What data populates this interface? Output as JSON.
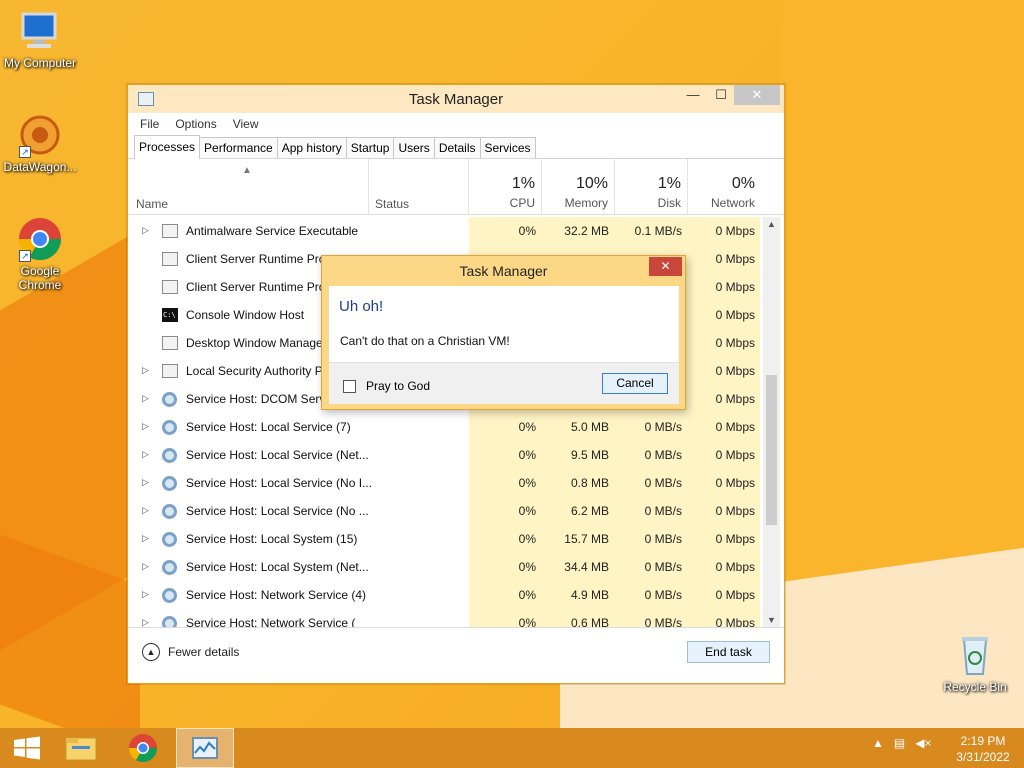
{
  "desktop": {
    "icons": [
      {
        "label": "My Computer",
        "icon": "computer-icon"
      },
      {
        "label": "DataWagon...",
        "icon": "datawagon-icon"
      },
      {
        "label": "Google Chrome",
        "icon": "chrome-icon"
      },
      {
        "label": "Recycle Bin",
        "icon": "recycle-bin-icon"
      }
    ]
  },
  "task_manager": {
    "title": "Task Manager",
    "window_buttons": {
      "minimize": "—",
      "maximize": "☐",
      "close": "✕"
    },
    "menu": [
      "File",
      "Options",
      "View"
    ],
    "tabs": [
      "Processes",
      "Performance",
      "App history",
      "Startup",
      "Users",
      "Details",
      "Services"
    ],
    "active_tab": "Processes",
    "columns": {
      "name": "Name",
      "status": "Status",
      "cpu": {
        "pct": "1%",
        "label": "CPU"
      },
      "memory": {
        "pct": "10%",
        "label": "Memory"
      },
      "disk": {
        "pct": "1%",
        "label": "Disk"
      },
      "network": {
        "pct": "0%",
        "label": "Network"
      }
    },
    "rows": [
      {
        "name": "Antimalware Service Executable",
        "cpu": "0%",
        "mem": "32.2 MB",
        "disk": "0.1 MB/s",
        "net": "0 Mbps",
        "expandable": true,
        "icon": "app-icon"
      },
      {
        "name": "Client Server Runtime Pro",
        "cpu": "",
        "mem": "",
        "disk": "",
        "net": "0 Mbps",
        "expandable": false,
        "icon": "app-icon"
      },
      {
        "name": "Client Server Runtime Pro",
        "cpu": "",
        "mem": "",
        "disk": "",
        "net": "0 Mbps",
        "expandable": false,
        "icon": "app-icon"
      },
      {
        "name": "Console Window Host",
        "cpu": "",
        "mem": "",
        "disk": "",
        "net": "0 Mbps",
        "expandable": false,
        "icon": "console-icon"
      },
      {
        "name": "Desktop Window Manage",
        "cpu": "",
        "mem": "",
        "disk": "",
        "net": "0 Mbps",
        "expandable": false,
        "icon": "app-icon"
      },
      {
        "name": "Local Security Authority P",
        "cpu": "",
        "mem": "",
        "disk": "",
        "net": "0 Mbps",
        "expandable": true,
        "icon": "app-icon"
      },
      {
        "name": "Service Host: DCOM Serve",
        "cpu": "",
        "mem": "",
        "disk": "",
        "net": "0 Mbps",
        "expandable": true,
        "icon": "gear-icon"
      },
      {
        "name": "Service Host: Local Service (7)",
        "cpu": "0%",
        "mem": "5.0 MB",
        "disk": "0 MB/s",
        "net": "0 Mbps",
        "expandable": true,
        "icon": "gear-icon"
      },
      {
        "name": "Service Host: Local Service (Net...",
        "cpu": "0%",
        "mem": "9.5 MB",
        "disk": "0 MB/s",
        "net": "0 Mbps",
        "expandable": true,
        "icon": "gear-icon"
      },
      {
        "name": "Service Host: Local Service (No I...",
        "cpu": "0%",
        "mem": "0.8 MB",
        "disk": "0 MB/s",
        "net": "0 Mbps",
        "expandable": true,
        "icon": "gear-icon"
      },
      {
        "name": "Service Host: Local Service (No ...",
        "cpu": "0%",
        "mem": "6.2 MB",
        "disk": "0 MB/s",
        "net": "0 Mbps",
        "expandable": true,
        "icon": "gear-icon"
      },
      {
        "name": "Service Host: Local System (15)",
        "cpu": "0%",
        "mem": "15.7 MB",
        "disk": "0 MB/s",
        "net": "0 Mbps",
        "expandable": true,
        "icon": "gear-icon"
      },
      {
        "name": "Service Host: Local System (Net...",
        "cpu": "0%",
        "mem": "34.4 MB",
        "disk": "0 MB/s",
        "net": "0 Mbps",
        "expandable": true,
        "icon": "gear-icon"
      },
      {
        "name": "Service Host: Network Service (4)",
        "cpu": "0%",
        "mem": "4.9 MB",
        "disk": "0 MB/s",
        "net": "0 Mbps",
        "expandable": true,
        "icon": "gear-icon"
      },
      {
        "name": "Service Host: Network Service (",
        "cpu": "0%",
        "mem": "0.6 MB",
        "disk": "0 MB/s",
        "net": "0 Mbps",
        "expandable": true,
        "icon": "gear-icon"
      }
    ],
    "fewer_details": "Fewer details",
    "end_task": "End task"
  },
  "dialog": {
    "title": "Task Manager",
    "close": "✕",
    "heading": "Uh oh!",
    "message": "Can't do that on a Christian VM!",
    "checkbox_label": "Pray to God",
    "checkbox_checked": false,
    "cancel": "Cancel"
  },
  "taskbar": {
    "apps": [
      "start-icon",
      "file-explorer-icon",
      "chrome-icon",
      "task-manager-icon"
    ],
    "active_app": "task-manager-icon",
    "clock_time": "2:19 PM",
    "clock_date": "3/31/2022"
  }
}
